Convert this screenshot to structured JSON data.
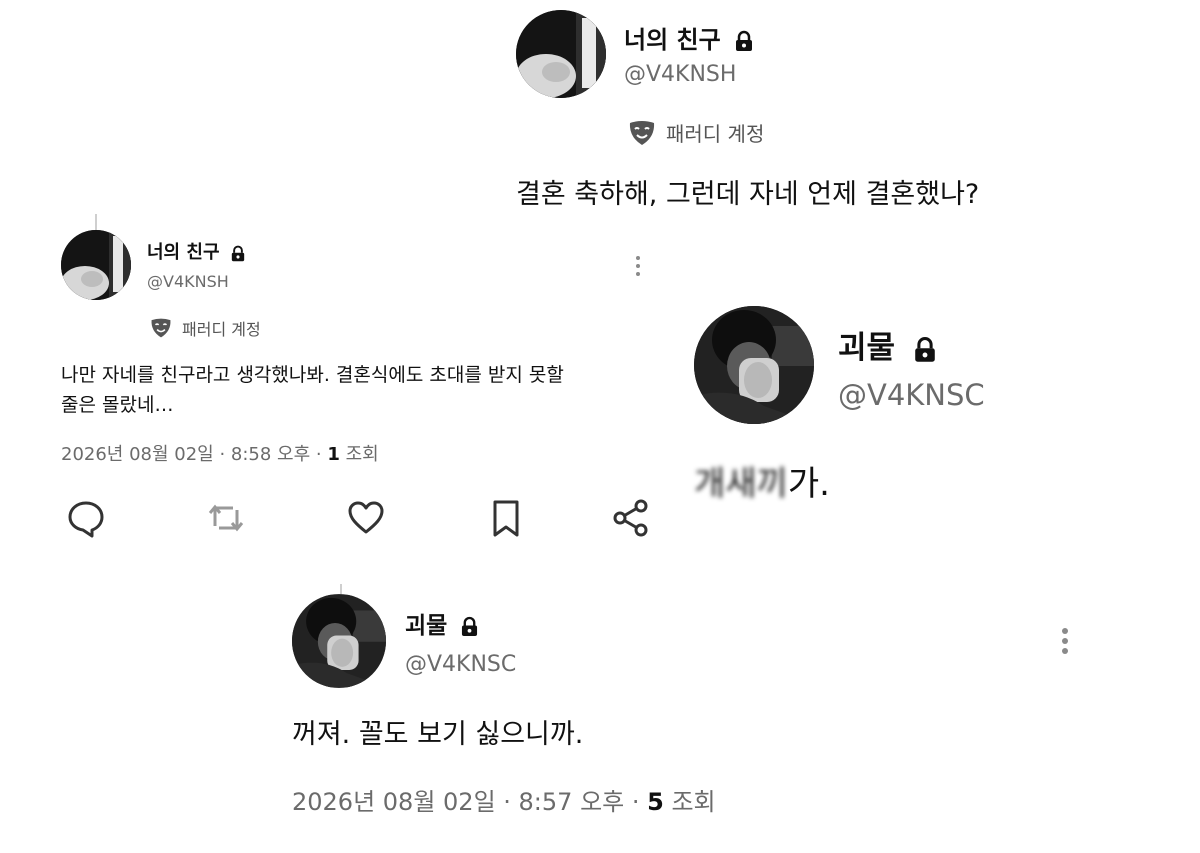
{
  "post_top": {
    "display_name": "너의 친구",
    "handle": "@V4KNSH",
    "parody_label": "패러디 계정",
    "text": "결혼 축하해, 그런데 자네 언제 결혼했나?"
  },
  "post_left": {
    "display_name": "너의 친구",
    "handle": "@V4KNSH",
    "parody_label": "패러디 계정",
    "text_line1": "나만 자네를 친구라고 생각했나봐. 결혼식에도 초대를 받지 못할",
    "text_line2": "줄은 몰랐네…",
    "date": "2026년 08월 02일 · 8:58 오후 · ",
    "views_count": "1",
    "views_label": " 조회",
    "actions": [
      "reply-icon",
      "repost-icon",
      "like-icon",
      "bookmark-icon",
      "share-icon"
    ]
  },
  "post_right": {
    "display_name": "괴물",
    "handle": "@V4KNSC",
    "text_blurred": "개새끼",
    "text_visible": "가."
  },
  "post_bottom": {
    "display_name": "괴물",
    "handle": "@V4KNSC",
    "text": "꺼져. 꼴도 보기 싫으니까.",
    "date": "2026년 08월 02일 · 8:57 오후 · ",
    "views_count": "5",
    "views_label": " 조회"
  }
}
